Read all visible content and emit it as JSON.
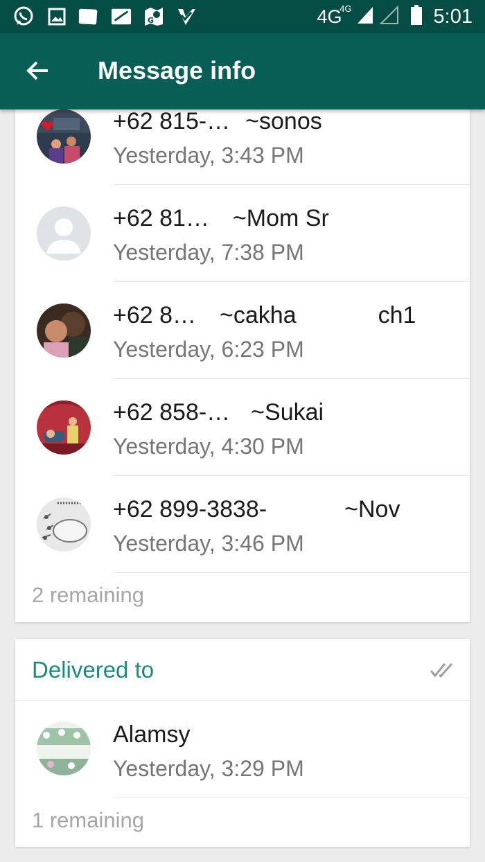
{
  "status_bar": {
    "network": "4G",
    "network_sup": "4G",
    "time": "5:01",
    "icons": [
      "whatsapp-icon",
      "gallery-icon",
      "message-icon",
      "card-icon",
      "maps-icon",
      "checklist-icon"
    ]
  },
  "app_bar": {
    "title": "Message info",
    "back_icon": "arrow-back-icon"
  },
  "read_by": {
    "items": [
      {
        "number": "+62 815-…",
        "name": "~sonos",
        "time": "Yesterday, 3:43 PM"
      },
      {
        "number": "+62 81…",
        "name": "~Mom Sr",
        "time": "Yesterday, 7:38 PM"
      },
      {
        "number": "+62 8…",
        "name": "~cakha",
        "name_tail": "ch1",
        "time": "Yesterday, 6:23 PM"
      },
      {
        "number": "+62 858-…",
        "name": "~Sukai",
        "time": "Yesterday, 4:30 PM"
      },
      {
        "number": "+62 899-3838-",
        "name": "~Nov",
        "time": "Yesterday, 3:46 PM"
      }
    ],
    "remaining": "2 remaining"
  },
  "delivered": {
    "title": "Delivered to",
    "icon": "double-check-icon",
    "items": [
      {
        "name": "Alamsy",
        "time": "Yesterday, 3:29 PM"
      }
    ],
    "remaining": "1 remaining"
  },
  "colors": {
    "status_bar": "#054d44",
    "app_bar": "#075e54",
    "accent": "#1b8b7e",
    "background": "#ececec"
  }
}
